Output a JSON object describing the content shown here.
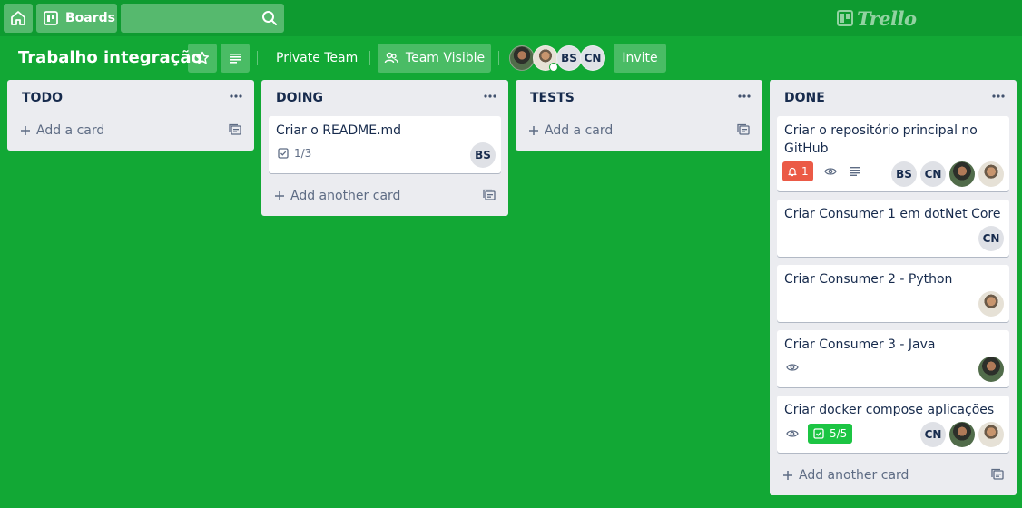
{
  "nav": {
    "boards_label": "Boards",
    "search_placeholder": "",
    "logo_text": "Trello"
  },
  "board": {
    "title": "Trabalho integração",
    "team_label": "Private Team",
    "visibility_label": "Team Visible",
    "invite_label": "Invite",
    "members": [
      {
        "type": "photo",
        "icon": "avatar-photo-dark"
      },
      {
        "type": "photo",
        "icon": "avatar-photo-light",
        "admin": true
      },
      {
        "type": "initials",
        "initials": "BS"
      },
      {
        "type": "initials",
        "initials": "CN"
      }
    ]
  },
  "lists": [
    {
      "title": "TODO",
      "add_label": "Add a card",
      "cards": []
    },
    {
      "title": "DOING",
      "add_label": "Add another card",
      "cards": [
        {
          "title": "Criar o README.md",
          "checklist": "1/3",
          "members": [
            "BS"
          ]
        }
      ]
    },
    {
      "title": "TESTS",
      "add_label": "Add a card",
      "cards": []
    },
    {
      "title": "DONE",
      "add_label": "Add another card",
      "cards": [
        {
          "title": "Criar o repositório principal no GitHub",
          "notifications": "1",
          "watching": true,
          "description": true,
          "members": [
            "BS",
            "CN",
            "photo-dark",
            "photo-light"
          ]
        },
        {
          "title": "Criar Consumer 1 em dotNet Core",
          "members": [
            "CN"
          ]
        },
        {
          "title": "Criar Consumer 2 - Python",
          "members": [
            "photo-light"
          ]
        },
        {
          "title": "Criar Consumer 3 - Java",
          "watching": true,
          "members": [
            "photo-dark"
          ]
        },
        {
          "title": "Criar docker compose aplicações",
          "watching": true,
          "checklist": "5/5",
          "checklist_complete": true,
          "members": [
            "CN",
            "photo-dark",
            "photo-light"
          ]
        }
      ]
    }
  ],
  "colors": {
    "board_bg": "#12a835",
    "nav_bg": "#0e9b30",
    "list_bg": "#ebecf0",
    "due_red": "#eb5a46",
    "checklist_green": "#1cc543"
  }
}
